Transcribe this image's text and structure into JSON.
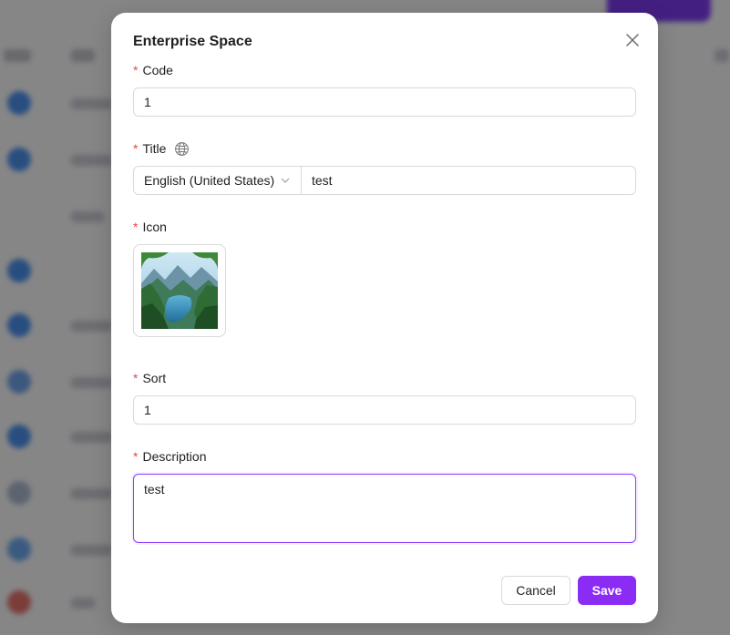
{
  "modal": {
    "title": "Enterprise Space",
    "close_icon": "close-icon"
  },
  "form": {
    "code": {
      "label": "Code",
      "value": "1",
      "required": true
    },
    "title": {
      "label": "Title",
      "label_icon": "globe-icon",
      "language": "English (United States)",
      "value": "test",
      "required": true
    },
    "icon": {
      "label": "Icon",
      "image": "mountain-lake-landscape",
      "required": true
    },
    "sort": {
      "label": "Sort",
      "value": "1",
      "required": true
    },
    "description": {
      "label": "Description",
      "value": "test",
      "required": true
    }
  },
  "footer": {
    "cancel_label": "Cancel",
    "save_label": "Save"
  },
  "colors": {
    "accent": "#8b2cf5",
    "required": "#e5484d",
    "focus_border": "#8b3dff"
  }
}
